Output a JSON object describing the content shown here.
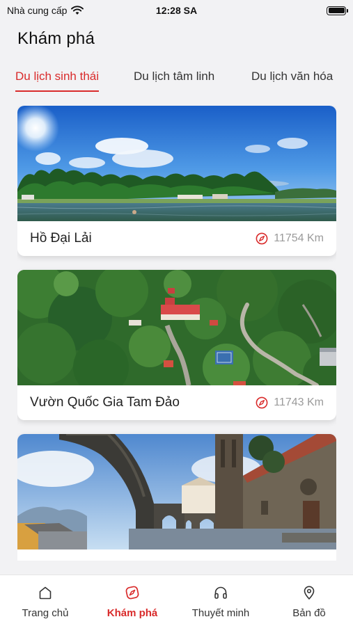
{
  "status_bar": {
    "carrier": "Nhà cung cấp",
    "time": "12:28 SA",
    "wifi_icon": "wifi-icon",
    "battery_icon": "battery-icon"
  },
  "page": {
    "title": "Khám phá"
  },
  "tabs": [
    {
      "label": "Du lịch sinh thái",
      "active": true
    },
    {
      "label": "Du lịch tâm linh",
      "active": false
    },
    {
      "label": "Du lịch văn hóa",
      "active": false
    }
  ],
  "places": [
    {
      "name": "Hồ Đại Lải",
      "distance": "11754 Km",
      "image": "lake-landscape"
    },
    {
      "name": "Vườn Quốc Gia Tam Đảo",
      "distance": "11743 Km",
      "image": "forest-aerial"
    },
    {
      "name": "",
      "distance": "",
      "image": "stone-church-arches"
    }
  ],
  "bottom_nav": [
    {
      "label": "Trang chủ",
      "icon": "home-icon",
      "active": false
    },
    {
      "label": "Khám phá",
      "icon": "explore-icon",
      "active": true
    },
    {
      "label": "Thuyết minh",
      "icon": "headphones-icon",
      "active": false
    },
    {
      "label": "Bản đồ",
      "icon": "map-pin-icon",
      "active": false
    }
  ],
  "colors": {
    "accent": "#d92b2b",
    "background": "#f2f2f4",
    "muted": "#9a9a9a"
  }
}
